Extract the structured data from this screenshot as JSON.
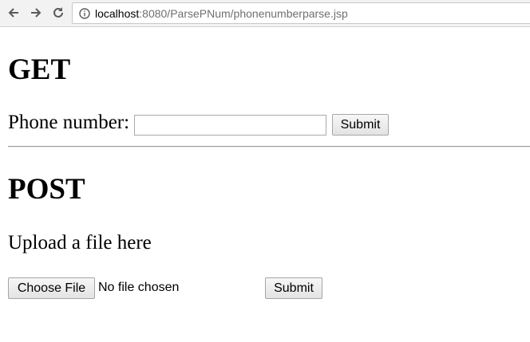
{
  "browser": {
    "url_host": "localhost",
    "url_rest": ":8080/ParsePNum/phonenumberparse.jsp"
  },
  "get_section": {
    "heading": "GET",
    "phone_label": "Phone number:",
    "phone_value": "",
    "submit_label": "Submit"
  },
  "post_section": {
    "heading": "POST",
    "upload_text": "Upload a file here",
    "choose_file_label": "Choose File",
    "file_status": "No file chosen",
    "submit_label": "Submit"
  }
}
